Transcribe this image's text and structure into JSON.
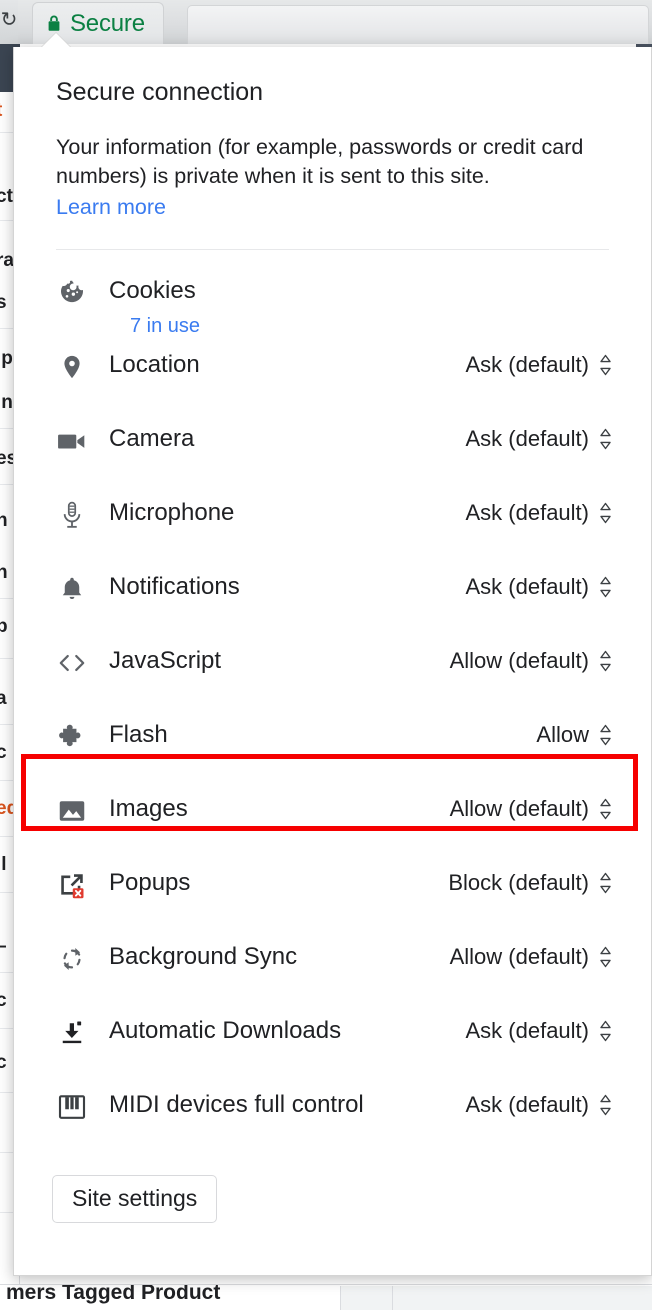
{
  "browser": {
    "reload_icon": "reload-icon",
    "origin_chip": {
      "icon": "lock-icon",
      "label": "Secure",
      "label_color": "#0b8043"
    },
    "background_page_text": "mers Tagged Product",
    "left_edge_fragments": [
      "t",
      "ct",
      "ra",
      "s",
      "ip",
      "In",
      "es",
      "n",
      "n",
      "p",
      "a",
      "c",
      "c",
      "ed",
      "ll",
      "-",
      "c",
      "c"
    ]
  },
  "popup": {
    "title": "Secure connection",
    "description": "Your information (for example, passwords or credit card numbers) is private when it is sent to this site.",
    "learn_more_label": "Learn more",
    "link_color": "#3a7bf0",
    "permissions": [
      {
        "icon": "cookie-icon",
        "name": "Cookies",
        "sublabel": "7 in use",
        "value": null,
        "has_select": false
      },
      {
        "icon": "location-pin-icon",
        "name": "Location",
        "sublabel": null,
        "value": "Ask (default)",
        "has_select": true
      },
      {
        "icon": "camera-icon",
        "name": "Camera",
        "sublabel": null,
        "value": "Ask (default)",
        "has_select": true
      },
      {
        "icon": "microphone-icon",
        "name": "Microphone",
        "sublabel": null,
        "value": "Ask (default)",
        "has_select": true
      },
      {
        "icon": "bell-icon",
        "name": "Notifications",
        "sublabel": null,
        "value": "Ask (default)",
        "has_select": true
      },
      {
        "icon": "code-brackets-icon",
        "name": "JavaScript",
        "sublabel": null,
        "value": "Allow (default)",
        "has_select": true
      },
      {
        "icon": "puzzle-piece-icon",
        "name": "Flash",
        "sublabel": null,
        "value": "Allow",
        "has_select": true,
        "highlighted": true
      },
      {
        "icon": "image-icon",
        "name": "Images",
        "sublabel": null,
        "value": "Allow (default)",
        "has_select": true
      },
      {
        "icon": "popup-blocked-icon",
        "name": "Popups",
        "sublabel": null,
        "value": "Block (default)",
        "has_select": true
      },
      {
        "icon": "sync-icon",
        "name": "Background Sync",
        "sublabel": null,
        "value": "Allow (default)",
        "has_select": true
      },
      {
        "icon": "download-icon",
        "name": "Automatic Downloads",
        "sublabel": null,
        "value": "Ask (default)",
        "has_select": true
      },
      {
        "icon": "midi-keyboard-icon",
        "name": "MIDI devices full control",
        "sublabel": null,
        "value": "Ask (default)",
        "has_select": true
      }
    ],
    "site_settings_label": "Site settings",
    "highlight_color": "#f60000"
  }
}
